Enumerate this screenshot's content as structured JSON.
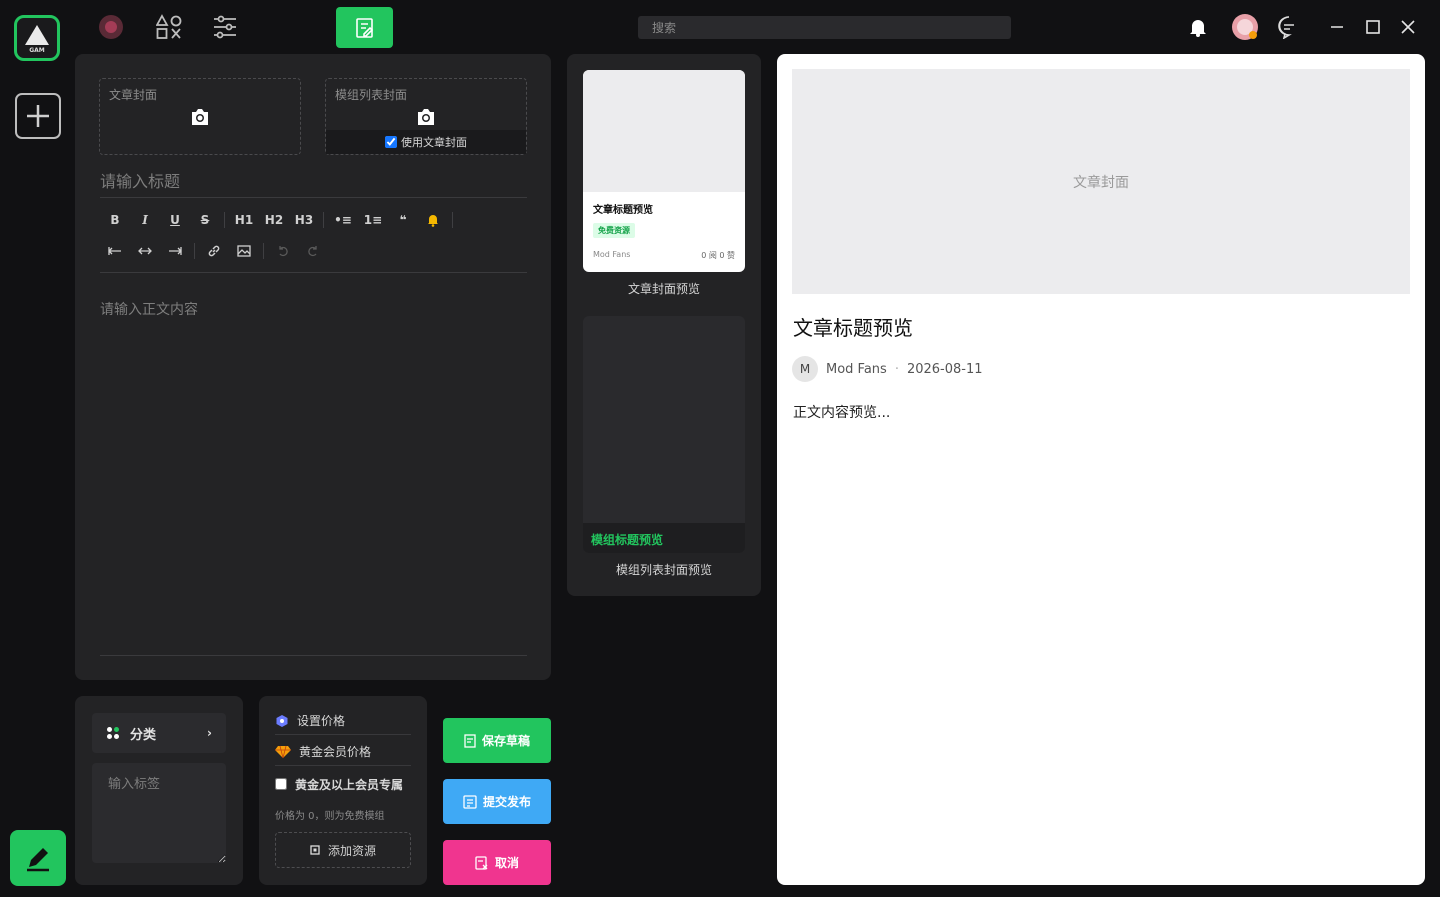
{
  "rail": {
    "logo_text": "GAM"
  },
  "topbar": {
    "search_placeholder": "搜索"
  },
  "editor": {
    "article_cover_label": "文章封面",
    "mod_cover_label": "模组列表封面",
    "use_article_cover_label": "使用文章封面",
    "use_article_cover_checked": true,
    "title_placeholder": "请输入标题",
    "body_placeholder": "请输入正文内容",
    "toolbar": {
      "bold": "B",
      "italic": "I",
      "underline": "U",
      "strike": "S",
      "h1": "H1",
      "h2": "H2",
      "h3": "H3",
      "ul": "•≡",
      "ol": "1≡",
      "quote": "❝"
    }
  },
  "category": {
    "label": "分类",
    "tag_placeholder": "输入标签"
  },
  "pricing": {
    "set_price": "设置价格",
    "gold_price": "黄金会员价格",
    "gold_exclusive": "黄金及以上会员专属",
    "note": "价格为 0，则为免费模组",
    "add_resource": "添加资源"
  },
  "actions": {
    "save": "保存草稿",
    "submit": "提交发布",
    "cancel": "取消"
  },
  "card_preview": {
    "title": "文章标题预览",
    "badge": "免费资源",
    "author": "Mod Fans",
    "stats": "0 阅 0 赞",
    "caption": "文章封面预览"
  },
  "mod_preview": {
    "title": "模组标题预览",
    "caption": "模组列表封面预览"
  },
  "article_preview": {
    "cover_label": "文章封面",
    "title": "文章标题预览",
    "avatar_letter": "M",
    "author": "Mod Fans",
    "dot": "·",
    "date": "2026-08-11",
    "body": "正文内容预览..."
  },
  "colors": {
    "accent_green": "#22c55e",
    "submit_blue": "#3fa9f5",
    "cancel_pink": "#f0358f"
  }
}
